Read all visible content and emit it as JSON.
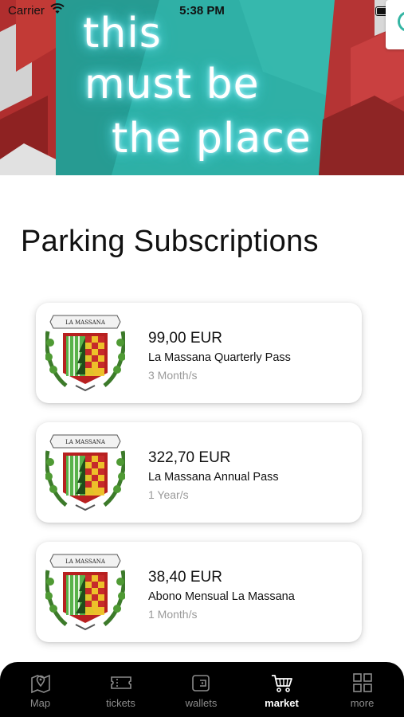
{
  "status_bar": {
    "carrier": "Carrier",
    "time": "5:38 PM",
    "battery_level_percent": 90
  },
  "hero": {
    "lines": [
      "this",
      "must be",
      "the place"
    ]
  },
  "page_title": "Parking Subscriptions",
  "subscriptions": [
    {
      "price": "99,00 EUR",
      "name": "La Massana Quarterly Pass",
      "duration": "3 Month/s",
      "logo_text": "LA MASSANA"
    },
    {
      "price": "322,70 EUR",
      "name": "La Massana Annual Pass",
      "duration": "1 Year/s",
      "logo_text": "LA MASSANA"
    },
    {
      "price": "38,40 EUR",
      "name": "Abono Mensual La Massana",
      "duration": "1 Month/s",
      "logo_text": "LA MASSANA"
    }
  ],
  "tab_bar": {
    "active_tab": "market",
    "tabs": [
      {
        "label": "Map",
        "icon": "map-pin-icon"
      },
      {
        "label": "tickets",
        "icon": "ticket-icon"
      },
      {
        "label": "wallets",
        "icon": "wallet-icon"
      },
      {
        "label": "market",
        "icon": "cart-icon"
      },
      {
        "label": "more",
        "icon": "grid-icon"
      }
    ]
  },
  "colors": {
    "accent_teal": "#2aa39a",
    "hero_red": "#b5302f",
    "tab_bar_bg": "#000000",
    "tab_active": "#ffffff",
    "tab_inactive": "#8c8c8c",
    "muted_text": "#9a9a9a"
  }
}
